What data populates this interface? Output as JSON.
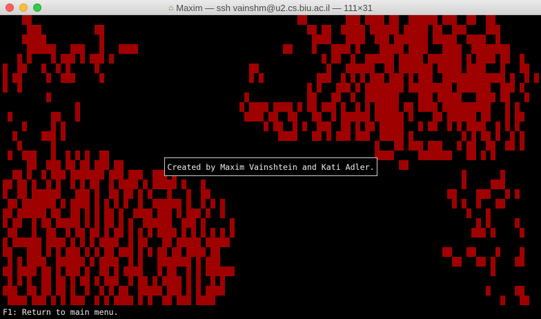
{
  "window": {
    "title": "Maxim — ssh vainshm@u2.cs.biu.ac.il — 111×31",
    "title_icon": "home-icon",
    "colors": {
      "cell": "#9f0000",
      "background": "#000000",
      "text": "#e6e6e6"
    }
  },
  "dialog": {
    "text": "Created by Maxim Vainshtein and Kati Adler."
  },
  "status": {
    "text": "F1: Return to main menu."
  },
  "grid": {
    "cols": 111,
    "rows": 30,
    "alive_symbol": "#",
    "pattern": [
      "....##.......................................................##........###.####.##..######.###..##..##.....",
      ".....###...........##..........................................##.##..#####.######.#####.##..###....###.....",
      "....#####...........#...........................................####...####..###.#######.#####..####..#.....",
      ".....######...###...#...####..............................##....#...####.#....#####.####...####..########.....",
      "...#.#....#.###.#.###.#...........................................#.##..#..######.#####.#######.#.####.##..#.",
      "#..##...#..#.#.....#...............................##..............#...######..##.#######.#####.####...#...##.",
      "#.##.....#..###.....#..............................#.#...........###..#.#.#.###.###.#.###..#############.#..#.#",
      "#..#...........................................................#.#...###.#.########.#########.#######..###.#.",
      ".........#........................................#............##...##..#..#######....###.#####...####.##...#",
      "...............#.................................#.####.####.#.##.###.#..#.#.#####.##.####.##########...#.#..",
      ".#........##...#..................................####.##..##...##..#.######.######.#....##.######.##...#.##..",
      "....#.....#.#.........................................#.##..#.#..###..##.#.##.#####...#.##..#.#.####..#.#.#...",
      "..#.....###.#............................................####...##.#.###.###..#####.#..........#.#.##.#..#.#.",
      "...#......#..................................................................#...##.###.###...#.##..##..##.#.",
      ".#..###...#..#.#.#..##.......................................................####.....#######...##.#.#.......",
      ".....##..###.##.##.###.##.........................................................##.......................",
      "..##.#..#.###.#######.###.###..###.#...........................................................#.......#....",
      "##.##.#..#.#..#.#.##..#.####.#.#####.#...#.....................................................#.....###....",
      "#..##.######...###.#..##.##.#.#...#...#..##.................................................##....###...#.#",
      ".##.#######.#.####.#.#.#.#..#..######.#..#.#.#...............................................#.#..#...##...",
      "##.######.##..##.#.#.##.#..####.###.#.###.#..#..................................................#...#.......",
      "#.##..#.##.#####.#.#.##.#.#..######..###.#.....#..................................................#.#.....#..",
      ".##...#..##..#.##.##.#.##.#.#.#.####.#.#.#.#.#.#.................................................###.#.....#",
      "#.######.####.#.#.#.####..#.##...##.#####.#####...............................................................",
      "##...###.#.#.###.#.#.##.###.#.#.##.##.####.##..............................................##...##....#....#",
      ".#.#.####..######.#.####..#.#...#######.#.###................................................##...##.#....##.",
      "##.####.##.#.###.#..##.#.####...#.##..#.#.######.....................................................#......",
      ".#.#.#..##.##.#.##.#.###..#.##.#.####.#.#..#.#..............................................................",
      "###..##.##.##.#..#..#.#.##..#####.###.#.#.####......................................................#.....##.",
      ".####.###.#.#.###..#.#.####.#.#..##.###.####...........................................................#...##"
    ]
  }
}
